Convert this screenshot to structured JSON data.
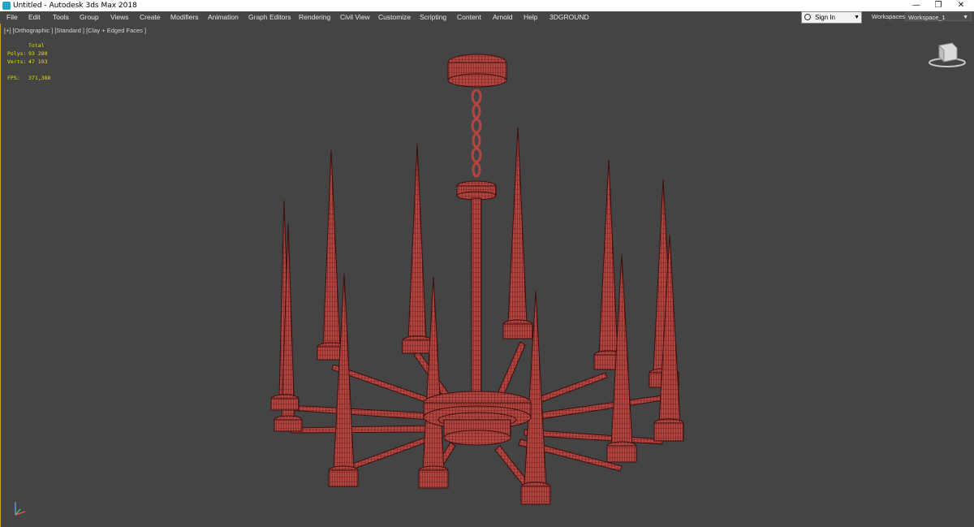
{
  "window": {
    "title": "Untitled - Autodesk 3ds Max 2018",
    "minimize_glyph": "—",
    "maximize_glyph": "❐",
    "close_glyph": "✕"
  },
  "menubar": {
    "items": [
      "File",
      "Edit",
      "Tools",
      "Group",
      "Views",
      "Create",
      "Modifiers",
      "Animation",
      "Graph Editors",
      "Rendering",
      "Civil View",
      "Customize",
      "Scripting",
      "Content",
      "Arnold",
      "Help",
      "3DGROUND"
    ],
    "sign_in_label": "Sign In",
    "workspaces_label": "Workspaces:",
    "workspace_value": "Workspace_1"
  },
  "viewport": {
    "label": "[+] [Orthographic ] [Standard ] [Clay + Edged Faces ]",
    "stats": {
      "header": "Total",
      "polys_label": "Polys:",
      "polys_value": "93 280",
      "verts_label": "Verts:",
      "verts_value": "47 193",
      "fps_label": "FPS:",
      "fps_value": "371,388"
    }
  },
  "colors": {
    "model_fill": "#b3443f",
    "model_wire": "#3a0f0e",
    "viewport_bg": "#444444",
    "stats_text": "#e1e000",
    "active_border": "#c8a326"
  },
  "icons": [
    "app-icon",
    "user-icon",
    "viewcube-icon",
    "axis-tripod-icon"
  ]
}
